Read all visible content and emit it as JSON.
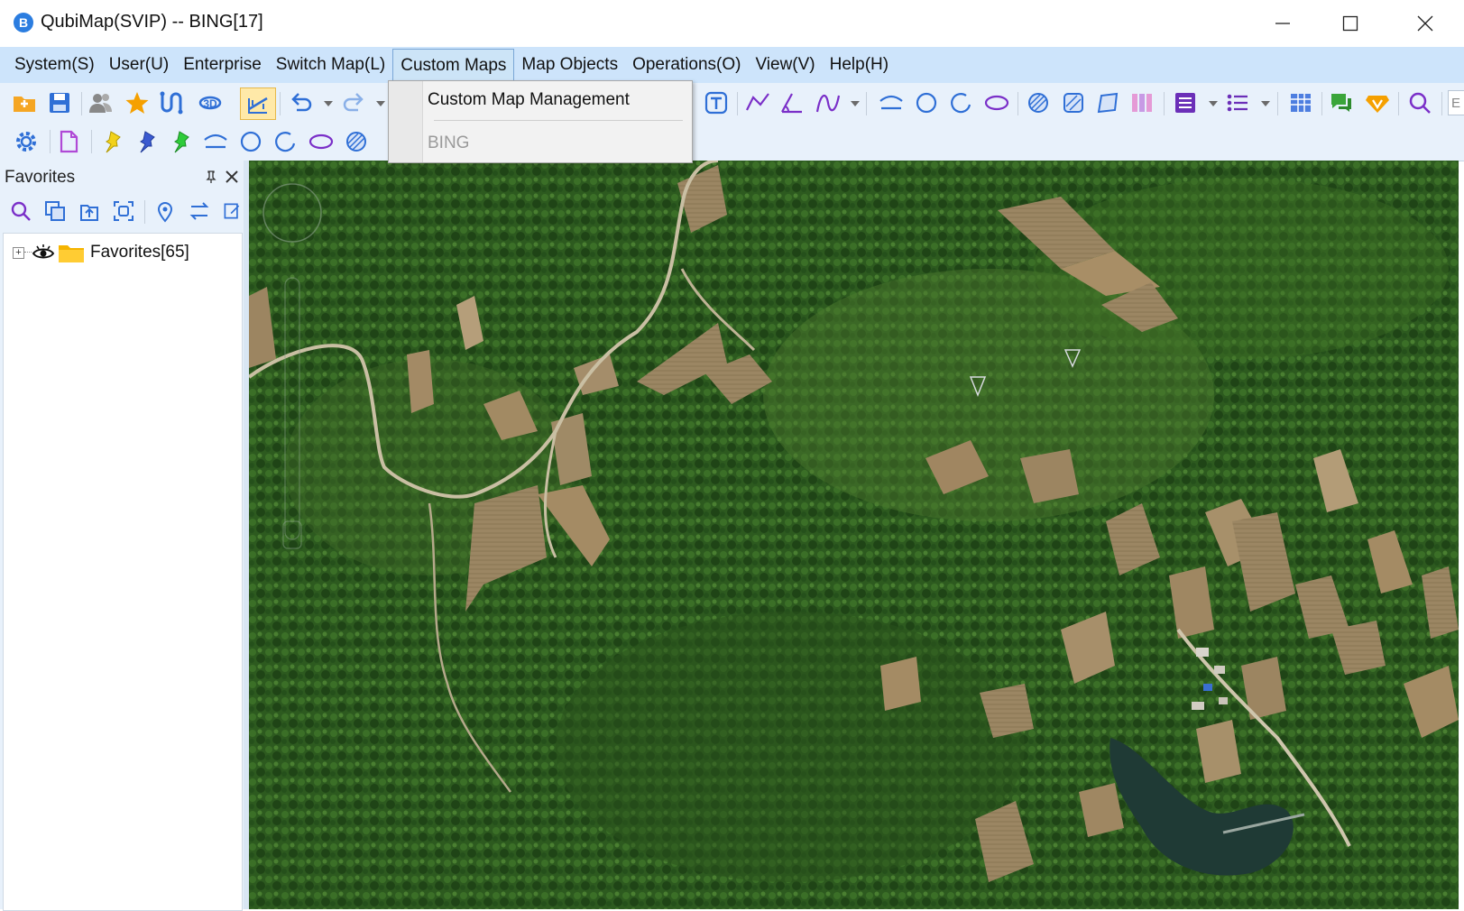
{
  "window": {
    "title": "QubiMap(SVIP) -- BING[17]",
    "app_icon": "qubimap-logo-icon",
    "controls": [
      "minimize-icon",
      "maximize-icon",
      "close-icon"
    ]
  },
  "menubar": {
    "items": [
      "System(S)",
      "User(U)",
      "Enterprise",
      "Switch Map(L)",
      "Custom Maps",
      "Map Objects",
      "Operations(O)",
      "View(V)",
      "Help(H)"
    ],
    "active": "Custom Maps"
  },
  "dropdown": {
    "items": [
      {
        "label": "Custom Map Management",
        "enabled": true
      },
      {
        "label": "BING",
        "enabled": false
      }
    ]
  },
  "toolbar1": {
    "icons": [
      "open-folder-icon",
      "save-icon",
      "users-icon",
      "star-icon",
      "route-icon",
      "3d-icon",
      "measure-icon",
      "undo-icon",
      "redo-icon",
      "text-icon",
      "polyline-icon",
      "angle-icon",
      "curve-icon",
      "arc-icon",
      "circle-icon",
      "partial-circle-icon",
      "ellipse-icon",
      "hatched-circle-icon",
      "hatched-square-icon",
      "hatched-shape-icon",
      "columns-icon",
      "list-view-icon",
      "bullet-list-icon",
      "table-icon",
      "chat-icon",
      "vip-badge-icon",
      "search-icon"
    ],
    "truncated_label": "E"
  },
  "toolbar2": {
    "icons": [
      "settings-icon",
      "document-icon",
      "yellow-pin-icon",
      "blue-pin-icon",
      "green-pin-icon",
      "arc-icon",
      "circle-icon",
      "partial-circle-icon",
      "ellipse-icon",
      "hatched-circle-icon"
    ]
  },
  "favorites_panel": {
    "title": "Favorites",
    "tool_icons": [
      "search-icon",
      "copy-icon",
      "import-icon",
      "screenshot-icon",
      "location-pin-icon",
      "swap-icon",
      "edit-icon"
    ],
    "tree": {
      "root_label": "Favorites[65]",
      "expand_symbol": "+"
    }
  },
  "map": {
    "source": "BING",
    "zoom_level": 17
  },
  "colors": {
    "menubar_bg": "#cde4fb",
    "toolbar_bg": "#e8f1fb",
    "accent_blue": "#2f6fd6",
    "purple_icon": "#7a2fc8"
  }
}
